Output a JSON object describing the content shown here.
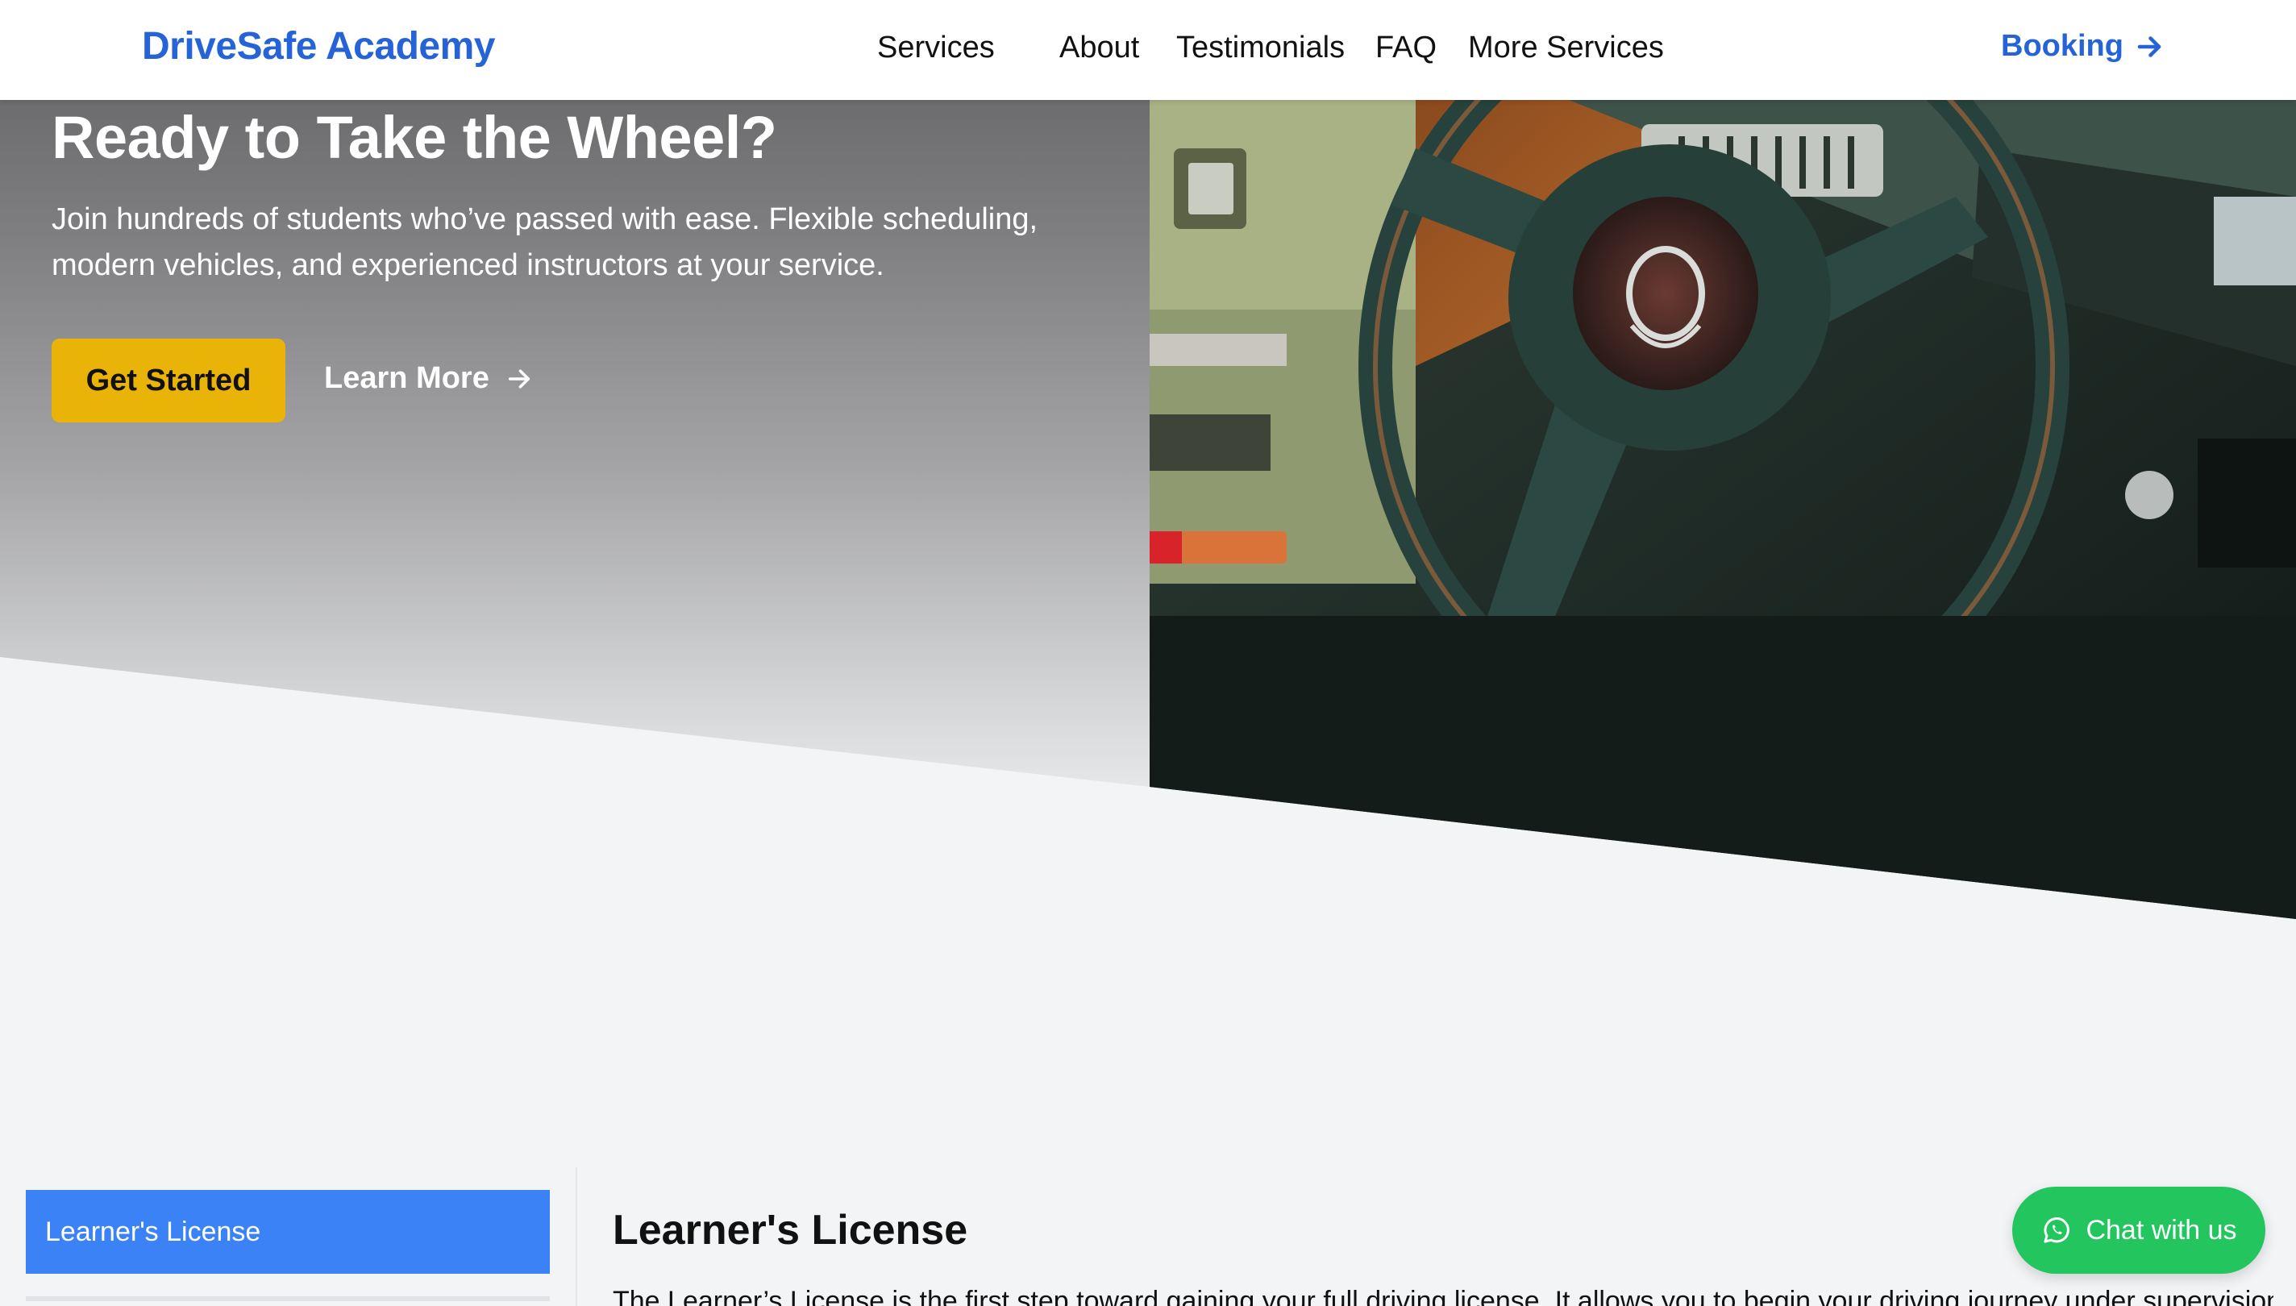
{
  "header": {
    "brand": "DriveSafe Academy",
    "nav": [
      "Services",
      "About",
      "Testimonials",
      "FAQ",
      "More Services"
    ],
    "booking_label": "Booking"
  },
  "hero": {
    "title": "Ready to Take the Wheel?",
    "text": "Join hundreds of students who’ve passed with ease. Flexible scheduling, modern vehicles, and experienced instructors at your service.",
    "primary_button": "Get Started",
    "secondary_button": "Learn More"
  },
  "sidebar": {
    "active_item": "Learner's License"
  },
  "content": {
    "title": "Learner's License",
    "text": "The Learner’s License is the first step toward gaining your full driving license. It allows you to begin your driving journey under supervision"
  },
  "chat": {
    "label": "Chat with us"
  },
  "colors": {
    "brand_blue": "#2563d6",
    "accent_yellow": "#eab308",
    "active_blue": "#3b82f6",
    "chat_green": "#22c55e"
  },
  "icons": [
    "arrow-right-icon",
    "whatsapp-icon",
    "steering-wheel-photo"
  ]
}
